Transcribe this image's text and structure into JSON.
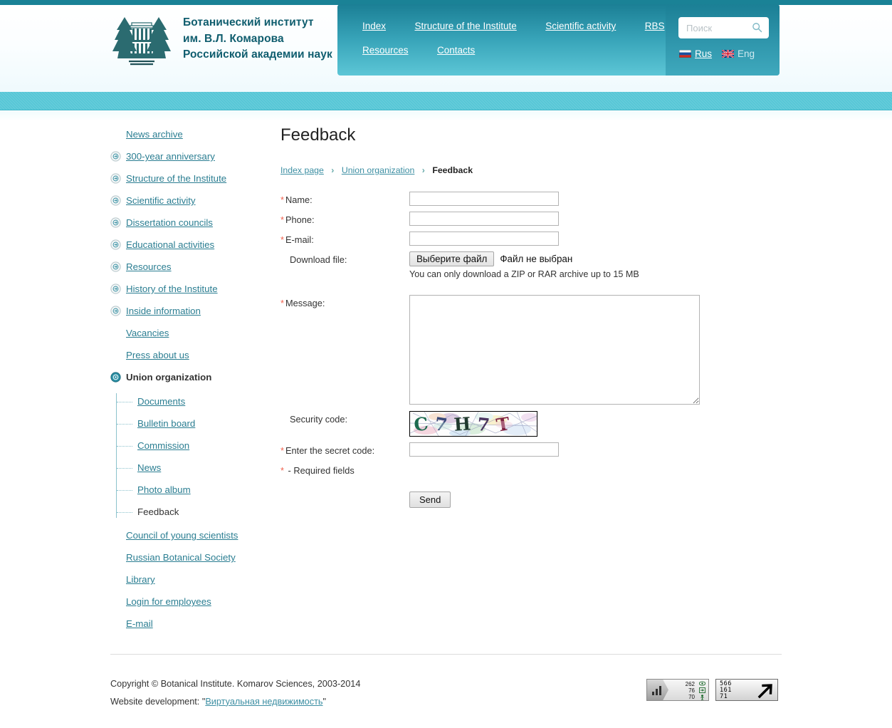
{
  "theme": {
    "accent": "#1a8296",
    "band": "#55c6d6",
    "link": "#2b7e92",
    "required": "#f0604d"
  },
  "header": {
    "logo_icon": "institute-firs-building-logo",
    "title_line1": "Ботанический институт",
    "title_line2": "им. В.Л. Комарова",
    "title_line3": "Российской академии наук"
  },
  "nav": {
    "row1": [
      {
        "label": "Index",
        "name": "nav-index"
      },
      {
        "label": "Structure of the Institute",
        "name": "nav-structure"
      },
      {
        "label": "Scientific activity",
        "name": "nav-scientific-activity"
      },
      {
        "label": "RBS",
        "name": "nav-rbs"
      }
    ],
    "row2": [
      {
        "label": "Resources",
        "name": "nav-resources"
      },
      {
        "label": "Contacts",
        "name": "nav-contacts"
      }
    ],
    "search": {
      "placeholder": "Поиск",
      "value": "",
      "icon": "search-icon"
    },
    "languages": [
      {
        "label": "Rus",
        "flag": "flag-russia",
        "active": true
      },
      {
        "label": "Eng",
        "flag": "flag-uk",
        "active": false
      }
    ]
  },
  "sidebar": {
    "items": [
      {
        "label": "News archive",
        "icon": false,
        "current": false
      },
      {
        "label": "300-year anniversary",
        "icon": true,
        "current": false
      },
      {
        "label": "Structure of the Institute",
        "icon": true,
        "current": false
      },
      {
        "label": "Scientific activity",
        "icon": true,
        "current": false
      },
      {
        "label": "Dissertation councils",
        "icon": true,
        "current": false
      },
      {
        "label": "Educational activities",
        "icon": true,
        "current": false
      },
      {
        "label": "Resources",
        "icon": true,
        "current": false
      },
      {
        "label": "History of the Institute",
        "icon": true,
        "current": false
      },
      {
        "label": "Inside information",
        "icon": true,
        "current": false
      },
      {
        "label": "Vacancies",
        "icon": false,
        "current": false
      },
      {
        "label": "Press about us",
        "icon": false,
        "current": false
      }
    ],
    "active_item": {
      "label": "Union organization",
      "icon": true,
      "current": true
    },
    "subitems": [
      {
        "label": "Documents",
        "current": false
      },
      {
        "label": "Bulletin board",
        "current": false
      },
      {
        "label": "Commission",
        "current": false
      },
      {
        "label": "News",
        "current": false
      },
      {
        "label": "Photo album",
        "current": false
      },
      {
        "label": "Feedback",
        "current": true
      }
    ],
    "tail_items": [
      {
        "label": "Council of young scientists"
      },
      {
        "label": "Russian Botanical Society"
      },
      {
        "label": "Library"
      },
      {
        "label": "Login for employees"
      },
      {
        "label": "E-mail"
      }
    ]
  },
  "main": {
    "title": "Feedback",
    "breadcrumb": {
      "items": [
        {
          "label": "Index page",
          "link": true
        },
        {
          "label": "Union organization",
          "link": true
        },
        {
          "label": "Feedback",
          "link": false
        }
      ],
      "separator": "›"
    },
    "form": {
      "name": {
        "label": "Name:",
        "required": true,
        "value": ""
      },
      "phone": {
        "label": "Phone:",
        "required": true,
        "value": ""
      },
      "email": {
        "label": "E-mail:",
        "required": true,
        "value": ""
      },
      "file": {
        "label": "Download file:",
        "required": false,
        "button": "Выберите файл",
        "status": "Файл не выбран",
        "hint": "You can only download a ZIP or RAR archive up to 15 MB"
      },
      "message": {
        "label": "Message:",
        "required": true,
        "value": ""
      },
      "security_code": {
        "label": "Security code:",
        "required": false,
        "captcha_text": "С7Н7Т"
      },
      "secret_code": {
        "label": "Enter the secret code:",
        "required": true,
        "value": ""
      },
      "required_note": "- Required fields",
      "submit": "Send"
    }
  },
  "footer": {
    "copyright": "Copyright © Botanical Institute. Komarov Sciences, 2003-2014",
    "development_prefix": "Website development: \"",
    "development_link": "Виртуальная недвижимость",
    "development_suffix": "\"",
    "counter_liveinternet": {
      "name": "liveinternet-counter",
      "values": [
        "262",
        "76",
        "70"
      ],
      "icons": [
        "views-eye-icon",
        "visits-arrow-icon",
        "visitors-person-icon"
      ]
    },
    "counter_rambler": {
      "name": "rambler-counter",
      "values": [
        "566",
        "161",
        "71"
      ],
      "icon": "arrow-up-right-icon"
    }
  }
}
